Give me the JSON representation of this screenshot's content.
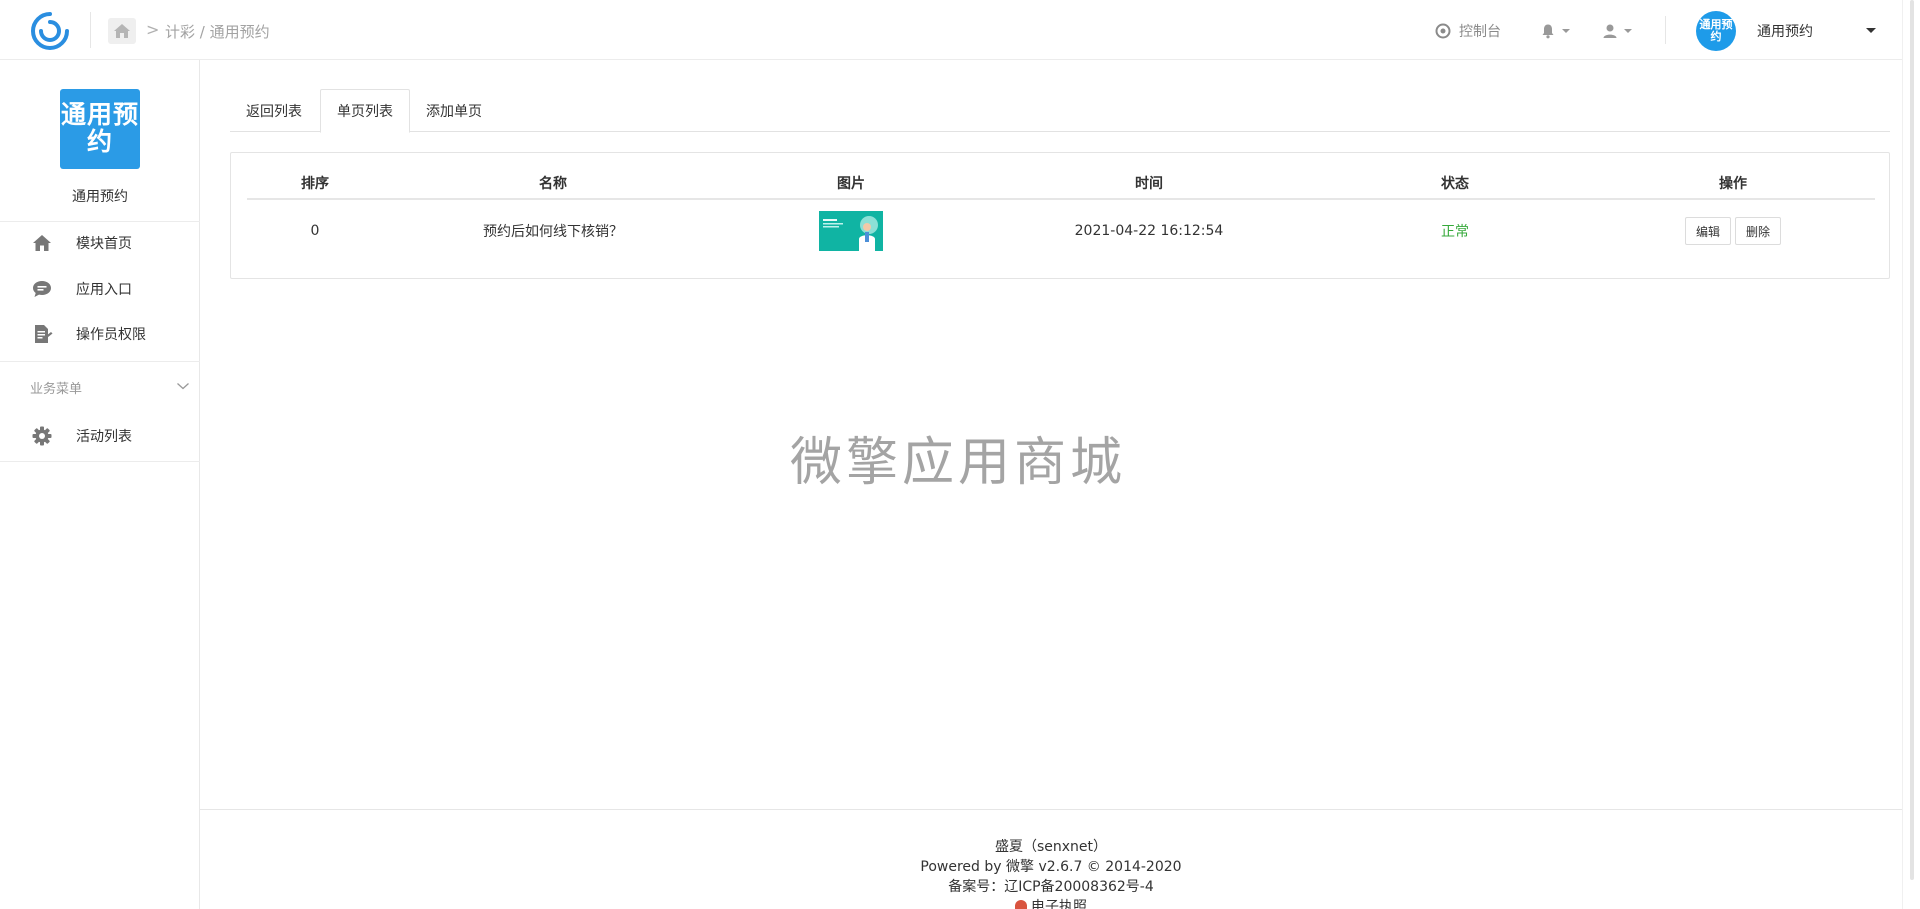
{
  "header": {
    "breadcrumb_sep": ">",
    "breadcrumb": "计彩 / 通用预约",
    "console_label": "控制台",
    "avatar_text": "通用预约",
    "app_name": "通用预约"
  },
  "sidebar": {
    "logo_text": "通用预约",
    "app_name": "通用预约",
    "items": [
      {
        "label": "模块首页",
        "icon": "home-icon"
      },
      {
        "label": "应用入口",
        "icon": "chat-icon"
      },
      {
        "label": "操作员权限",
        "icon": "document-edit-icon"
      }
    ],
    "group_label": "业务菜单",
    "group_items": [
      {
        "label": "活动列表",
        "icon": "gear-icon"
      }
    ]
  },
  "tabs": [
    {
      "label": "返回列表",
      "active": false
    },
    {
      "label": "单页列表",
      "active": true
    },
    {
      "label": "添加单页",
      "active": false
    }
  ],
  "table": {
    "columns": [
      "排序",
      "名称",
      "图片",
      "时间",
      "状态",
      "操作"
    ],
    "rows": [
      {
        "sort": "0",
        "name": "预约后如何线下核销？",
        "time": "2021-04-22 16:12:54",
        "status": "正常",
        "actions": [
          "编辑",
          "删除"
        ]
      }
    ]
  },
  "watermark": "微擎应用商城",
  "footer": {
    "line1": "盛夏（senxnet）",
    "line2": "Powered by 微擎 v2.6.7 © 2014-2020",
    "line3": "备案号：辽ICP备20008362号-4",
    "line4": "电子执照"
  },
  "colors": {
    "brand_blue": "#2b9be6",
    "status_green": "#36a93b"
  }
}
